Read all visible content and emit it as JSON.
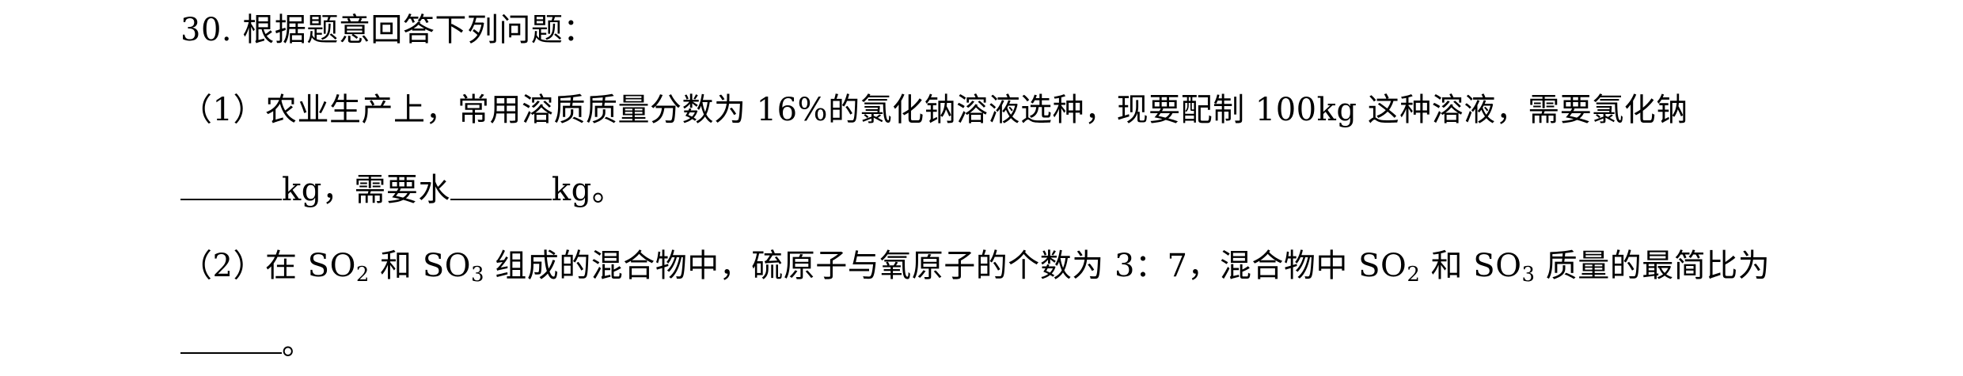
{
  "question": {
    "number": "30.",
    "title": "根据题意回答下列问题："
  },
  "part1": {
    "line1": "（1）农业生产上，常用溶质质量分数为 16%的氯化钠溶液选种，现要配制 100kg 这种溶液，需要氯化钠",
    "unit_a": "kg，需要水",
    "unit_b": "kg。"
  },
  "part2": {
    "prefix": "（2）在 SO",
    "sub1": "2",
    "and1": " 和 SO",
    "sub2": "3",
    "middle": " 组成的混合物中，硫原子与氧原子的个数为 3：7，混合物中 SO",
    "sub3": "2",
    "and2": " 和 SO",
    "sub4": "3",
    "suffix": " 质量的最简比为",
    "end": "。"
  }
}
